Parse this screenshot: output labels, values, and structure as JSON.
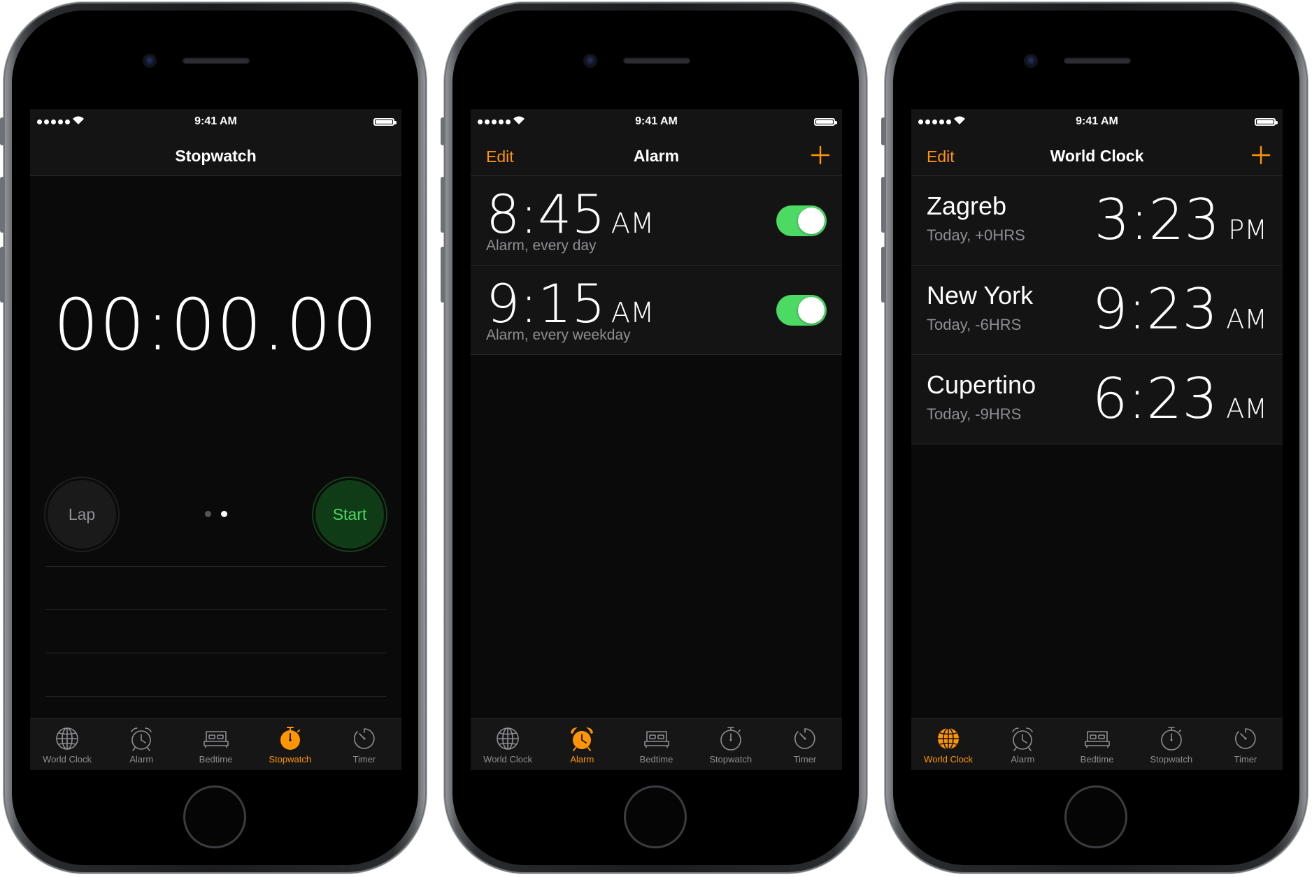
{
  "colors": {
    "accent": "#ff9500",
    "toggle_on": "#4cd964",
    "start_green": "#4cd964",
    "inactive": "#8e8e93"
  },
  "status": {
    "time": "9:41 AM"
  },
  "tabs": [
    {
      "label": "World Clock",
      "icon": "globe-icon"
    },
    {
      "label": "Alarm",
      "icon": "alarm-clock-icon"
    },
    {
      "label": "Bedtime",
      "icon": "bed-icon"
    },
    {
      "label": "Stopwatch",
      "icon": "stopwatch-icon"
    },
    {
      "label": "Timer",
      "icon": "timer-icon"
    }
  ],
  "stopwatch": {
    "title": "Stopwatch",
    "display": "00:00.00",
    "lap_label": "Lap",
    "start_label": "Start",
    "active_tab": "Stopwatch"
  },
  "alarm": {
    "title": "Alarm",
    "edit_label": "Edit",
    "active_tab": "Alarm",
    "items": [
      {
        "time": "8:45",
        "ampm": "AM",
        "label": "Alarm, every day",
        "enabled": true
      },
      {
        "time": "9:15",
        "ampm": "AM",
        "label": "Alarm, every weekday",
        "enabled": true
      }
    ]
  },
  "worldclock": {
    "title": "World Clock",
    "edit_label": "Edit",
    "active_tab": "World Clock",
    "cities": [
      {
        "city": "Zagreb",
        "offset": "Today, +0HRS",
        "time": "3:23",
        "ampm": "PM"
      },
      {
        "city": "New York",
        "offset": "Today, -6HRS",
        "time": "9:23",
        "ampm": "AM"
      },
      {
        "city": "Cupertino",
        "offset": "Today, -9HRS",
        "time": "6:23",
        "ampm": "AM"
      }
    ]
  }
}
